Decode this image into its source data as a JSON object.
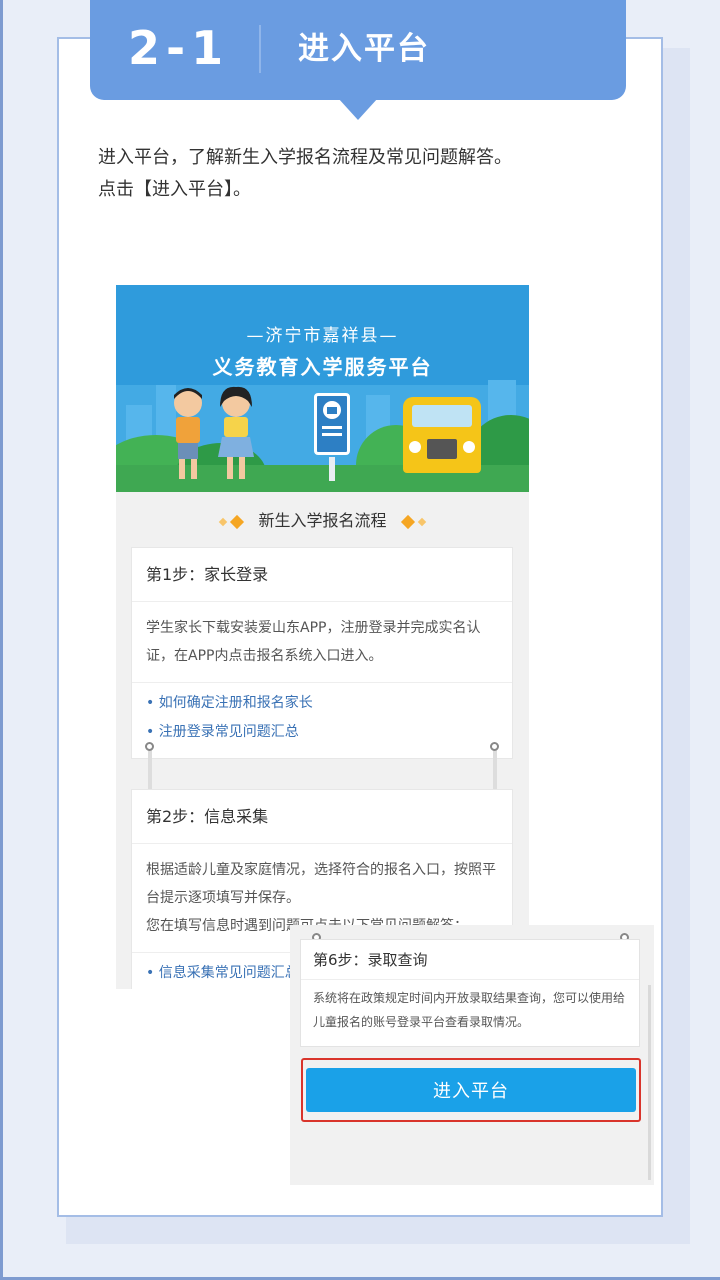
{
  "header": {
    "number": "2-1",
    "title": "进入平台"
  },
  "intro": {
    "line1": "进入平台，了解新生入学报名流程及常见问题解答。",
    "line2": "点击【进入平台】。"
  },
  "platform": {
    "subtitle": "—济宁市嘉祥县—",
    "title": "义务教育入学服务平台",
    "flow_heading": "新生入学报名流程",
    "steps": [
      {
        "title": "第1步：家长登录",
        "body": "学生家长下载安装爱山东APP，注册登录并完成实名认证，在APP内点击报名系统入口进入。",
        "links": [
          "• 如何确定注册和报名家长",
          "• 注册登录常见问题汇总"
        ]
      },
      {
        "title": "第2步：信息采集",
        "body": "根据适龄儿童及家庭情况，选择符合的报名入口，按照平台提示逐项填写并保存。",
        "note": "您在填写信息时遇到问题可点击以下常见问题解答：",
        "links": [
          "• 信息采集常见问题汇总"
        ]
      }
    ],
    "step6": {
      "title": "第6步：录取查询",
      "body": "系统将在政策规定时间内开放录取结果查询，您可以使用给儿童报名的账号登录平台查看录取情况。"
    },
    "enter_button": "进入平台"
  },
  "colors": {
    "ribbon": "#6a9ce1",
    "card_border": "#a4bde6",
    "banner_sky": "#2f9bdc",
    "link": "#3a72b5",
    "button": "#1aa1e8",
    "highlight": "#d9342b",
    "accent_diamond": "#f5a623"
  }
}
